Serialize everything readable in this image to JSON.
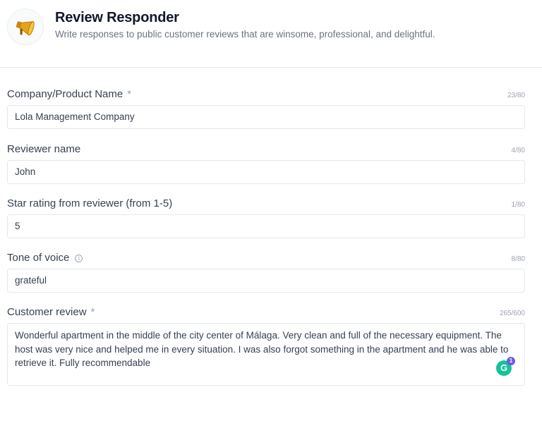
{
  "app": {
    "title": "Review Responder",
    "subtitle": "Write responses to public customer reviews that are winsome, professional, and delightful.",
    "logo_icon": "megaphone-icon"
  },
  "fields": [
    {
      "label": "Company/Product Name",
      "required": "*",
      "count": "23/80",
      "value": "Lola Management Company"
    },
    {
      "label": "Reviewer name",
      "count": "4/80",
      "value": "John"
    },
    {
      "label": "Star rating from reviewer (from 1-5)",
      "count": "1/80",
      "value": "5"
    },
    {
      "label": "Tone of voice",
      "count": "8/80",
      "value": "grateful",
      "info_icon": "i"
    },
    {
      "label": "Customer review",
      "required": "*",
      "count": "265/600",
      "value": "Wonderful apartment in the middle of the city center of Málaga. Very clean and full of the necessary equipment. The host was very nice and helped me in every situation. I was also forgot something in the apartment and he was able to retrieve it. Fully recommendable"
    }
  ],
  "grammarly": {
    "letter": "G",
    "badge": "1",
    "color": "#15c39a"
  }
}
